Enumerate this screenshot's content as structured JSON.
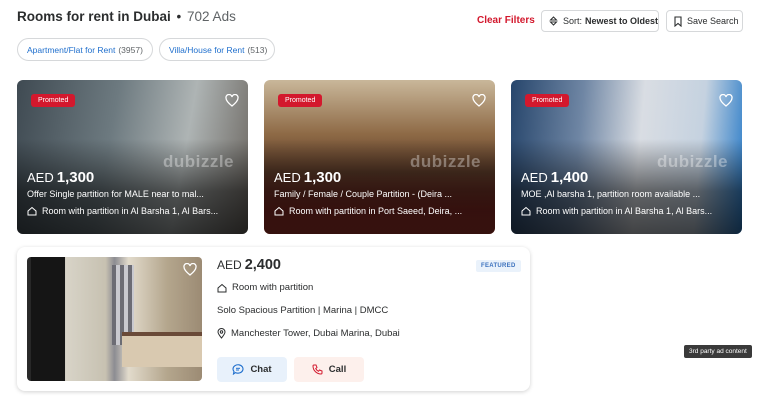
{
  "header": {
    "title": "Rooms for rent in Dubai",
    "separator": "•",
    "ads_count": "702 Ads",
    "clear_filters": "Clear Filters",
    "sort_label": "Sort:",
    "sort_value": "Newest to Oldest",
    "save_search": "Save Search"
  },
  "chips": [
    {
      "label": "Apartment/Flat for Rent",
      "count": "(3957)"
    },
    {
      "label": "Villa/House for Rent",
      "count": "(513)"
    }
  ],
  "listings": [
    {
      "badge": "Promoted",
      "currency": "AED",
      "price": "1,300",
      "title": "Offer Single partition for MALE near to mal...",
      "type_location": "Room with partition in Al Barsha 1, Al Bars...",
      "watermark": "dubizzle"
    },
    {
      "badge": "Promoted",
      "currency": "AED",
      "price": "1,300",
      "title": "Family / Female / Couple Partition - (Deira ...",
      "type_location": "Room with partition in Port Saeed, Deira, ...",
      "watermark": "dubizzle"
    },
    {
      "badge": "Promoted",
      "currency": "AED",
      "price": "1,400",
      "title": "MOE ,Al barsha 1, partition room available ...",
      "type_location": "Room with partition in Al Barsha 1, Al Bars...",
      "watermark": "dubizzle"
    }
  ],
  "featured": {
    "currency": "AED",
    "price": "2,400",
    "badge": "FEATURED",
    "type": "Room with partition",
    "title": "Solo Spacious Partition | Marina | DMCC",
    "location": "Manchester Tower, Dubai Marina, Dubai",
    "chat_label": "Chat",
    "call_label": "Call"
  },
  "third_party_label": "3rd party ad content",
  "colors": {
    "brand_red": "#d3182d",
    "link_blue": "#1f6fcd",
    "chat_bg": "#e8f1fb",
    "call_bg": "#fdf0ec"
  },
  "icons": [
    "sort-icon",
    "bookmark-icon",
    "heart-icon",
    "home-icon",
    "location-pin-icon",
    "chat-icon",
    "phone-icon"
  ]
}
